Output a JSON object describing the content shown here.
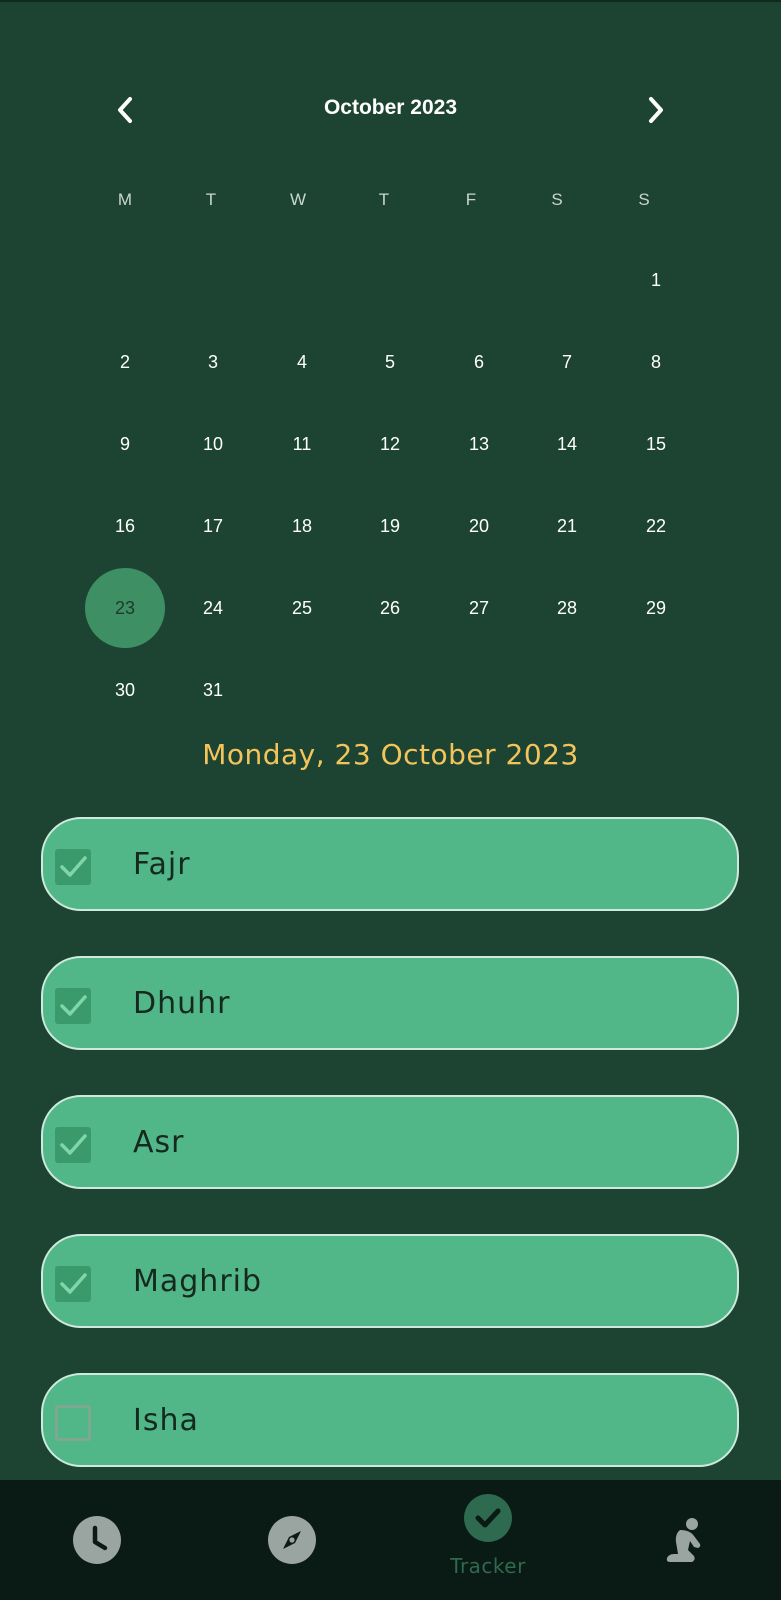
{
  "calendar": {
    "month_title": "October 2023",
    "weekdays": [
      "M",
      "T",
      "W",
      "T",
      "F",
      "S",
      "S"
    ],
    "days": [
      "1",
      "2",
      "3",
      "4",
      "5",
      "6",
      "7",
      "8",
      "9",
      "10",
      "11",
      "12",
      "13",
      "14",
      "15",
      "16",
      "17",
      "18",
      "19",
      "20",
      "21",
      "22",
      "23",
      "24",
      "25",
      "26",
      "27",
      "28",
      "29",
      "30",
      "31"
    ],
    "first_weekday_index": 6,
    "selected_day": "23"
  },
  "selected_date_label": "Monday, 23 October 2023",
  "prayers": [
    {
      "name": "Fajr",
      "checked": true
    },
    {
      "name": "Dhuhr",
      "checked": true
    },
    {
      "name": "Asr",
      "checked": true
    },
    {
      "name": "Maghrib",
      "checked": true
    },
    {
      "name": "Isha",
      "checked": false
    }
  ],
  "bottom_nav": {
    "active_label": "Tracker",
    "items": [
      {
        "icon": "clock-icon"
      },
      {
        "icon": "compass-icon"
      },
      {
        "icon": "check-circle-icon",
        "label": "Tracker",
        "active": true
      },
      {
        "icon": "prayer-person-icon"
      }
    ]
  },
  "colors": {
    "background": "#1d4433",
    "card": "#52b788",
    "accent_date": "#f2c45a",
    "selected_day": "#3f8f65",
    "nav_bg": "#0a1a14"
  }
}
